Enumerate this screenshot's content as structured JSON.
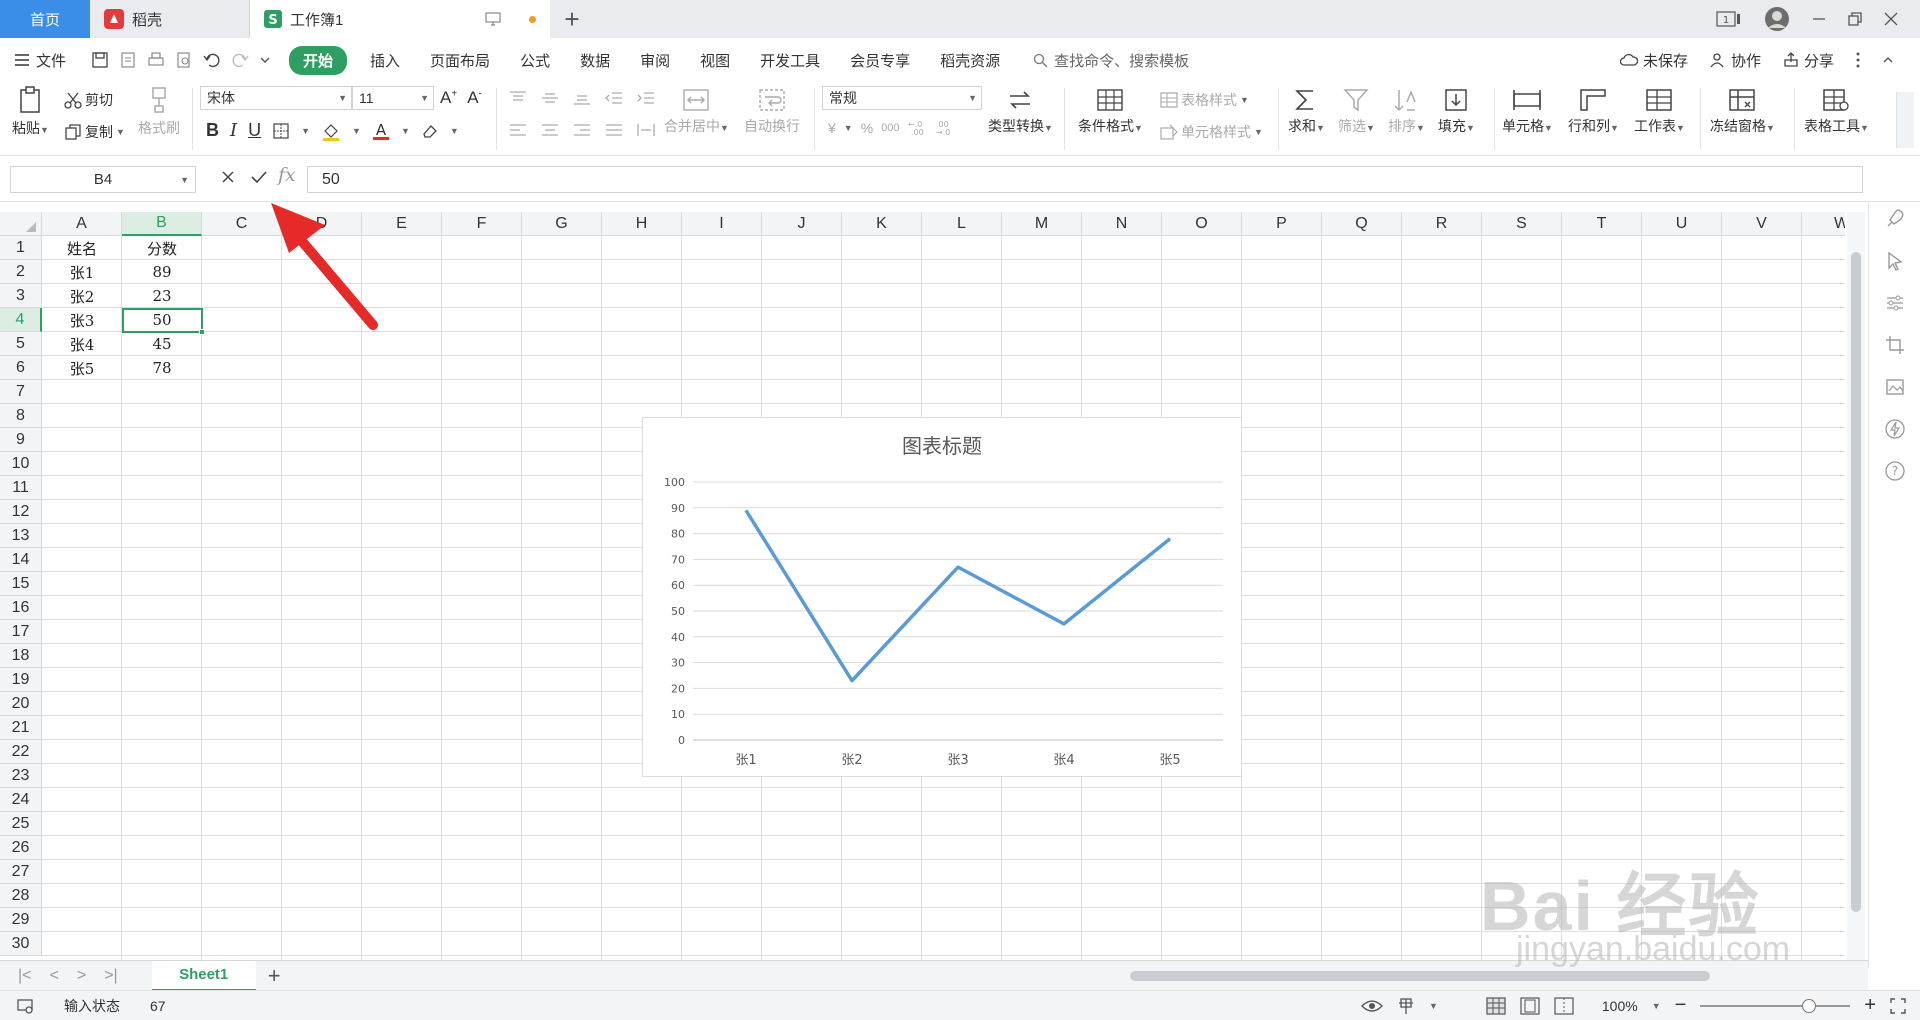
{
  "tabs": {
    "home": "首页",
    "doc": "稻壳",
    "book": "工作簿1"
  },
  "menu": {
    "file": "文件",
    "items": [
      "开始",
      "插入",
      "页面布局",
      "公式",
      "数据",
      "审阅",
      "视图",
      "开发工具",
      "会员专享",
      "稻壳资源"
    ],
    "search_placeholder": "查找命令、搜索模板",
    "unsaved": "未保存",
    "collab": "协作",
    "share": "分享"
  },
  "ribbon": {
    "paste": "粘贴",
    "cut": "剪切",
    "copy": "复制",
    "format_painter": "格式刷",
    "font_name": "宋体",
    "font_size": "11",
    "merge_center": "合并居中",
    "wrap_text": "自动换行",
    "number_format": "常规",
    "type_convert": "类型转换",
    "conditional_format": "条件格式",
    "table_style": "表格样式",
    "cell_style": "单元格样式",
    "sum": "求和",
    "filter": "筛选",
    "sort": "排序",
    "fill": "填充",
    "cell": "单元格",
    "rows_cols": "行和列",
    "worksheet": "工作表",
    "freeze_panes": "冻结窗格",
    "table_tools": "表格工具",
    "currency_symbol": "¥",
    "percent_symbol": "%",
    "thousands_symbol": "000"
  },
  "formula_bar": {
    "name_box": "B4",
    "fx": "fx",
    "value": "50"
  },
  "columns": [
    "A",
    "B",
    "C",
    "D",
    "E",
    "F",
    "G",
    "H",
    "I",
    "J",
    "K",
    "L",
    "M",
    "N",
    "O",
    "P",
    "Q",
    "R",
    "S",
    "T",
    "U",
    "V",
    "W"
  ],
  "rows": [
    "1",
    "2",
    "3",
    "4",
    "5",
    "6",
    "7",
    "8",
    "9",
    "10",
    "11",
    "12",
    "13",
    "14",
    "15",
    "16",
    "17",
    "18",
    "19",
    "20",
    "21",
    "22",
    "23",
    "24",
    "25",
    "26",
    "27",
    "28",
    "29",
    "30"
  ],
  "table": {
    "header": [
      "姓名",
      "分数"
    ],
    "rows": [
      [
        "张1",
        "89"
      ],
      [
        "张2",
        "23"
      ],
      [
        "张3",
        "50"
      ],
      [
        "张4",
        "45"
      ],
      [
        "张5",
        "78"
      ]
    ]
  },
  "chart_data": {
    "type": "line",
    "title": "图表标题",
    "categories": [
      "张1",
      "张2",
      "张3",
      "张4",
      "张5"
    ],
    "series": [
      {
        "values": [
          89,
          23,
          67,
          45,
          78
        ],
        "color": "#5b9bd5"
      }
    ],
    "ylim": [
      0,
      100
    ],
    "yticks": [
      0,
      10,
      20,
      30,
      40,
      50,
      60,
      70,
      80,
      90,
      100
    ],
    "grid": true
  },
  "sheets": {
    "active": "Sheet1"
  },
  "status": {
    "mode": "输入状态",
    "value": "67",
    "zoom": "100%"
  },
  "colors": {
    "accent": "#2f9e62",
    "home_tab": "#3b8ee8",
    "arrow": "#e52a2a"
  },
  "watermark": {
    "brand": "Bai 经验",
    "url": "jingyan.baidu.com"
  }
}
